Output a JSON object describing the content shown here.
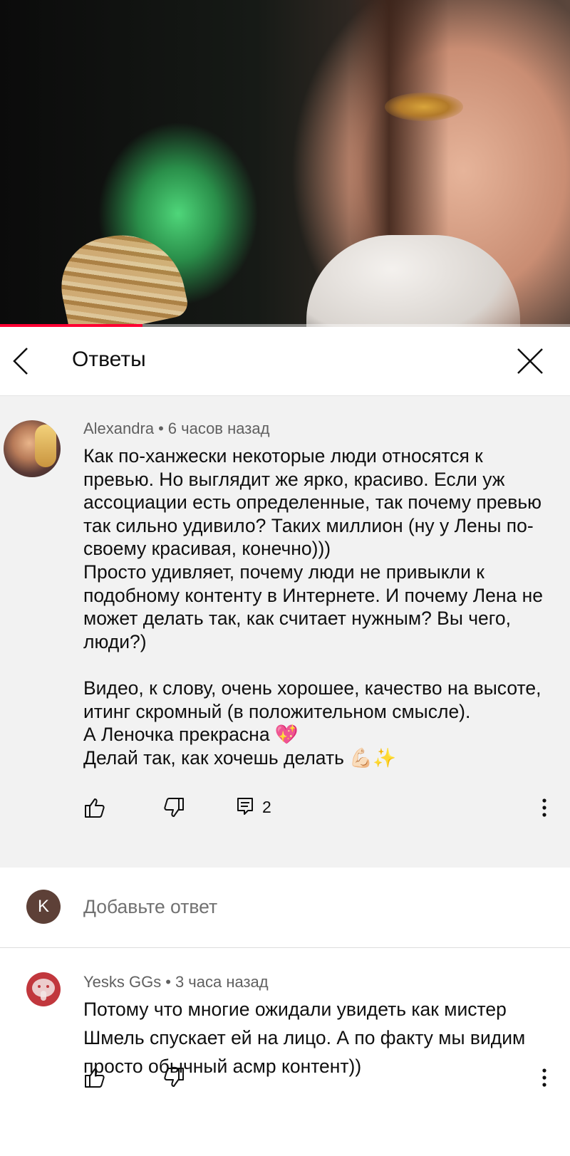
{
  "video": {
    "progress_fraction": 0.25
  },
  "header": {
    "title": "Ответы"
  },
  "main_comment": {
    "author": "Alexandra",
    "separator": "•",
    "time": "6 часов назад",
    "text": "Как по-ханжески некоторые люди относятся к превью. Но выглядит же ярко, красиво. Если уж ассоциации есть определенные, так почему превью так сильно удивило? Таких миллион (ну у Лены по-своему красивая, конечно)))\nПросто удивляет, почему люди не привыкли к подобному контенту в Интернете. И почему Лена не может делать так, как считает нужным? Вы чего, люди?)\n\nВидео, к слову, очень хорошее, качество на высоте, итинг скромный (в положительном смысле).\nА Леночка прекрасна 💖\nДелай так, как хочешь делать 💪🏻✨",
    "reply_count": "2"
  },
  "add_reply": {
    "avatar_letter": "K",
    "placeholder": "Добавьте ответ"
  },
  "reply": {
    "author": "Yesks GGs",
    "separator": "•",
    "time": "3 часа назад",
    "text": "Потому что многие ожидали увидеть как мистер Шмель спускает ей на лицо. А по факту мы видим просто обычный асмр контент))"
  },
  "colors": {
    "progress": "#ff0033",
    "comment_bg": "#f2f2f2",
    "meta_text": "#606060",
    "avatar_k": "#5d4037",
    "avatar_y": "#c1373d"
  }
}
